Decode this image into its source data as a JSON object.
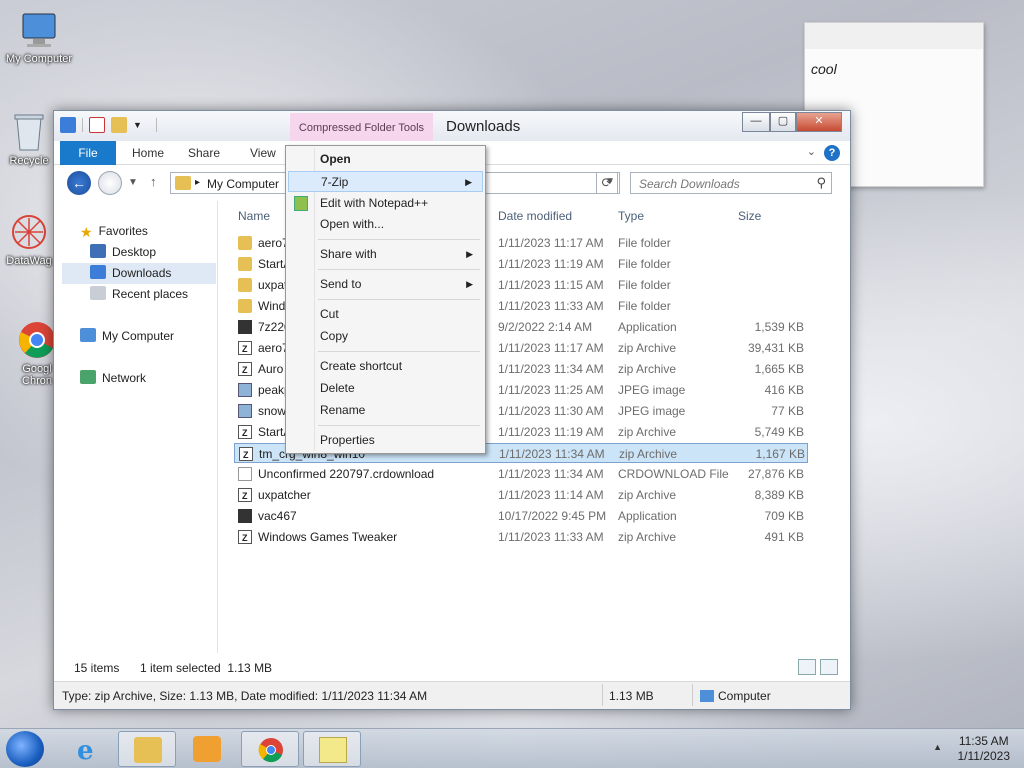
{
  "desktop": {
    "icons": [
      {
        "label": "My Computer",
        "icon": "computer-icon"
      },
      {
        "label": "Recycle",
        "icon": "recycle-bin-icon"
      },
      {
        "label": "DataWag",
        "icon": "datawag-icon"
      },
      {
        "label": "Googl Chron",
        "icon": "chrome-icon"
      }
    ]
  },
  "sticky_note": {
    "text": "cool"
  },
  "window": {
    "title": "Downloads",
    "contextual_tab_header": "Compressed Folder Tools",
    "controls": {
      "minimize": "—",
      "maximize": "▢",
      "close": "✕"
    },
    "ribbon_tabs": [
      "File",
      "Home",
      "Share",
      "View"
    ],
    "address": {
      "path": "My Computer"
    },
    "search": {
      "placeholder": "Search Downloads"
    },
    "nav_pane": {
      "favorites": "Favorites",
      "desktop": "Desktop",
      "downloads": "Downloads",
      "recent": "Recent places",
      "computer": "My Computer",
      "network": "Network"
    },
    "columns": {
      "name": "Name",
      "date": "Date modified",
      "type": "Type",
      "size": "Size"
    },
    "files": [
      {
        "name": "aero7",
        "date": "1/11/2023 11:17 AM",
        "type": "File folder",
        "size": "",
        "icon": "folder"
      },
      {
        "name": "StartA",
        "date": "1/11/2023 11:19 AM",
        "type": "File folder",
        "size": "",
        "icon": "folder"
      },
      {
        "name": "uxpat",
        "date": "1/11/2023 11:15 AM",
        "type": "File folder",
        "size": "",
        "icon": "folder"
      },
      {
        "name": "Wind",
        "date": "1/11/2023 11:33 AM",
        "type": "File folder",
        "size": "",
        "icon": "folder"
      },
      {
        "name": "7z220",
        "date": "9/2/2022 2:14 AM",
        "type": "Application",
        "size": "1,539 KB",
        "icon": "app"
      },
      {
        "name": "aero7",
        "date": "1/11/2023 11:17 AM",
        "type": "zip Archive",
        "size": "39,431 KB",
        "icon": "zip"
      },
      {
        "name": "Auro",
        "date": "1/11/2023 11:34 AM",
        "type": "zip Archive",
        "size": "1,665 KB",
        "icon": "zip"
      },
      {
        "name": "peakp",
        "date": "1/11/2023 11:25 AM",
        "type": "JPEG image",
        "size": "416 KB",
        "icon": "jpg"
      },
      {
        "name": "snow",
        "date": "1/11/2023 11:30 AM",
        "type": "JPEG image",
        "size": "77 KB",
        "icon": "jpg"
      },
      {
        "name": "StartA",
        "date": "1/11/2023 11:19 AM",
        "type": "zip Archive",
        "size": "5,749 KB",
        "icon": "zip"
      },
      {
        "name": "tm_crg_win8_win10",
        "date": "1/11/2023 11:34 AM",
        "type": "zip Archive",
        "size": "1,167 KB",
        "icon": "zip"
      },
      {
        "name": "Unconfirmed 220797.crdownload",
        "date": "1/11/2023 11:34 AM",
        "type": "CRDOWNLOAD File",
        "size": "27,876 KB",
        "icon": "blank"
      },
      {
        "name": "uxpatcher",
        "date": "1/11/2023 11:14 AM",
        "type": "zip Archive",
        "size": "8,389 KB",
        "icon": "zip"
      },
      {
        "name": "vac467",
        "date": "10/17/2022 9:45 PM",
        "type": "Application",
        "size": "709 KB",
        "icon": "app"
      },
      {
        "name": "Windows Games Tweaker",
        "date": "1/11/2023 11:33 AM",
        "type": "zip Archive",
        "size": "491 KB",
        "icon": "zip"
      }
    ],
    "status": {
      "count": "15 items",
      "selected": "1 item selected  1.13 MB"
    },
    "details_bar": {
      "info": "Type: zip Archive, Size: 1.13 MB, Date modified: 1/11/2023 11:34 AM",
      "size": "1.13 MB",
      "location": "Computer"
    }
  },
  "context_menu": {
    "items": [
      {
        "label": "Open"
      },
      {
        "label": "7-Zip"
      },
      {
        "label": "Edit with Notepad++"
      },
      {
        "label": "Open with..."
      },
      {
        "label": "Share with"
      },
      {
        "label": "Send to"
      },
      {
        "label": "Cut"
      },
      {
        "label": "Copy"
      },
      {
        "label": "Create shortcut"
      },
      {
        "label": "Delete"
      },
      {
        "label": "Rename"
      },
      {
        "label": "Properties"
      }
    ]
  },
  "taskbar": {
    "apps": [
      "internet-explorer-icon",
      "file-explorer-icon",
      "media-player-icon",
      "chrome-icon",
      "sticky-notes-icon"
    ],
    "clock": {
      "time": "11:35 AM",
      "date": "1/11/2023"
    }
  },
  "colors": {
    "accent": "#1979ca",
    "selection": "#cce4f7",
    "context_tab": "#f6d6ec"
  }
}
